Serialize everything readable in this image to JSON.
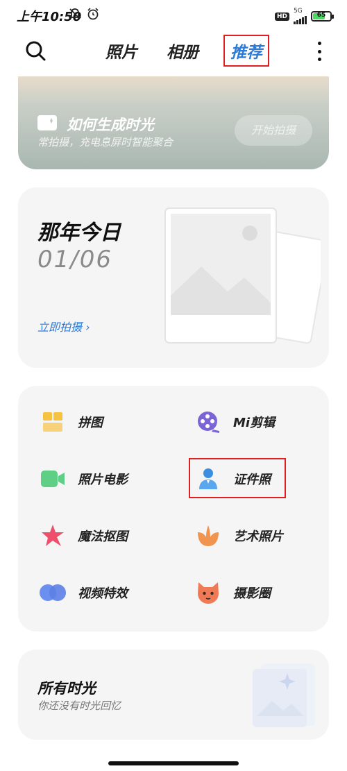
{
  "status_bar": {
    "time": "上午10:50",
    "hd": "HD",
    "network": "5G",
    "battery": "65"
  },
  "top_bar": {
    "tabs": [
      {
        "label": "照片"
      },
      {
        "label": "相册"
      },
      {
        "label": "推荐"
      }
    ]
  },
  "banner": {
    "title": "如何生成时光",
    "subtitle": "常拍摄，充电息屏时智能聚合",
    "button": "开始拍摄"
  },
  "memory": {
    "title": "那年今日",
    "date": "01/06",
    "link": "立即拍摄 ›"
  },
  "tools": [
    {
      "label": "拼图",
      "icon": "collage-icon"
    },
    {
      "label": "Mi剪辑",
      "icon": "film-reel-icon"
    },
    {
      "label": "照片电影",
      "icon": "video-camera-icon"
    },
    {
      "label": "证件照",
      "icon": "id-photo-icon"
    },
    {
      "label": "魔法抠图",
      "icon": "star-cutout-icon"
    },
    {
      "label": "艺术照片",
      "icon": "flower-icon"
    },
    {
      "label": "视频特效",
      "icon": "overlapping-circles-icon"
    },
    {
      "label": "摄影圈",
      "icon": "fox-face-icon"
    }
  ],
  "moments": {
    "title": "所有时光",
    "subtitle": "你还没有时光回忆"
  },
  "colors": {
    "accent": "#2e7bd8",
    "highlight": "#e02020",
    "card_bg": "#f5f5f5"
  }
}
